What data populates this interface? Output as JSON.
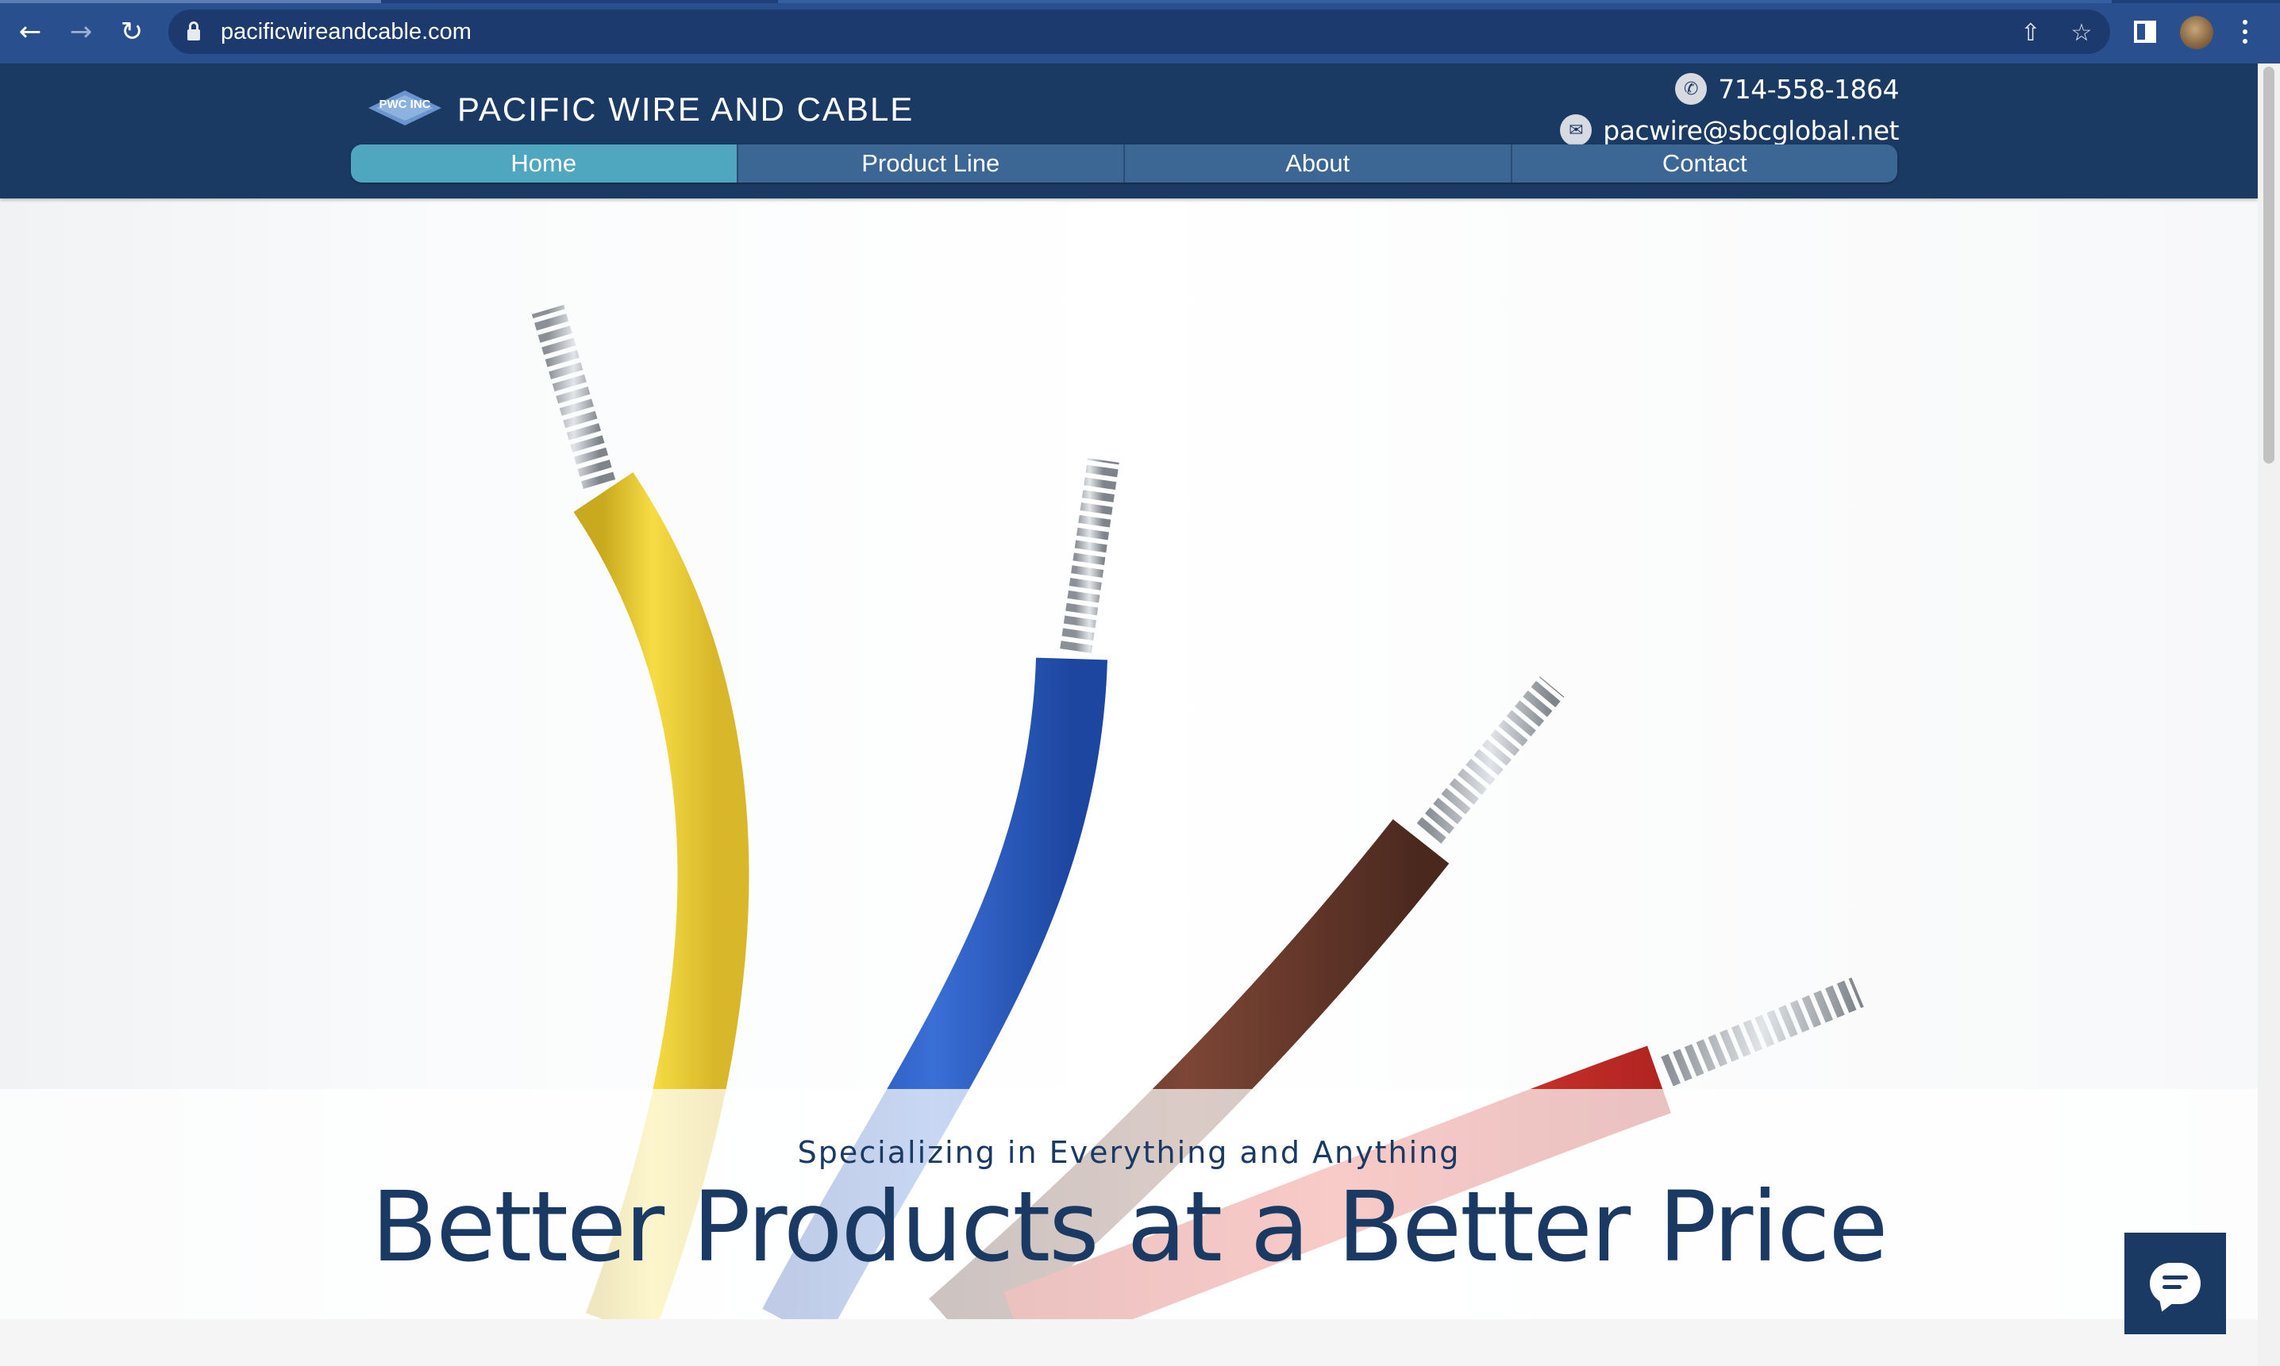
{
  "browser": {
    "url": "pacificwireandcable.com"
  },
  "site": {
    "logo_text": "PWC INC",
    "brand_name": "PACIFIC WIRE AND CABLE",
    "phone": "714-558-1864",
    "email": "pacwire@sbcglobal.net",
    "nav": [
      {
        "label": "Home",
        "active": true
      },
      {
        "label": "Product Line",
        "active": false
      },
      {
        "label": "About",
        "active": false
      },
      {
        "label": "Contact",
        "active": false
      }
    ]
  },
  "hero": {
    "subtitle": "Specializing in Everything and Anything",
    "title": "Better Products at a Better Price"
  },
  "colors": {
    "header_bg": "#1b3a63",
    "nav_bg": "#3c6693",
    "nav_active": "#4fa6bf",
    "browser_chrome": "#2a4f8f",
    "wire_yellow": "#f2d43a",
    "wire_blue": "#2a5fc4",
    "wire_brown": "#6b3a2c",
    "wire_red": "#d9352e"
  },
  "icons": {
    "back": "arrow-left-icon",
    "forward": "arrow-right-icon",
    "reload": "reload-icon",
    "lock": "lock-icon",
    "share": "share-icon",
    "bookmark": "star-icon",
    "side_panel": "side-panel-icon",
    "menu": "kebab-menu-icon",
    "phone": "phone-icon",
    "email": "envelope-icon",
    "chat": "chat-icon"
  }
}
